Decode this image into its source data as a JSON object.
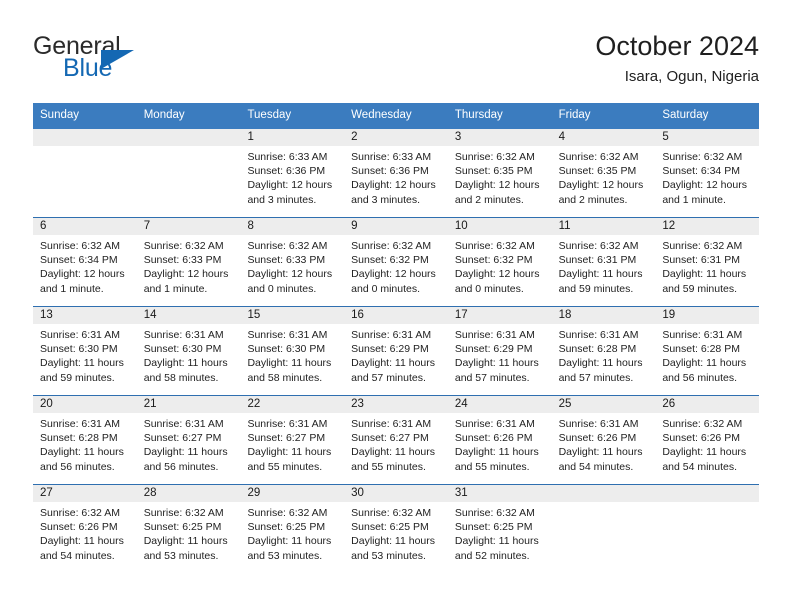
{
  "logo": {
    "primary_text": "General",
    "secondary_text": "Blue",
    "primary_color": "#2b2b2b",
    "secondary_color": "#1468b3",
    "triangle_icon": "triangle-right-icon"
  },
  "header": {
    "title": "October 2024",
    "subtitle": "Isara, Ogun, Nigeria"
  },
  "theme": {
    "header_bg": "#3b7cbf",
    "header_text": "#ffffff",
    "row_divider": "#2f6fb0",
    "day_band_bg": "#ededed",
    "cell_bg": "#ffffff"
  },
  "weekdays": [
    "Sunday",
    "Monday",
    "Tuesday",
    "Wednesday",
    "Thursday",
    "Friday",
    "Saturday"
  ],
  "weeks": [
    [
      {
        "day": "",
        "sunrise": "",
        "sunset": "",
        "daylight_line1": "",
        "daylight_line2": "",
        "empty": true
      },
      {
        "day": "",
        "sunrise": "",
        "sunset": "",
        "daylight_line1": "",
        "daylight_line2": "",
        "empty": true
      },
      {
        "day": "1",
        "sunrise": "Sunrise: 6:33 AM",
        "sunset": "Sunset: 6:36 PM",
        "daylight_line1": "Daylight: 12 hours",
        "daylight_line2": "and 3 minutes.",
        "empty": false
      },
      {
        "day": "2",
        "sunrise": "Sunrise: 6:33 AM",
        "sunset": "Sunset: 6:36 PM",
        "daylight_line1": "Daylight: 12 hours",
        "daylight_line2": "and 3 minutes.",
        "empty": false
      },
      {
        "day": "3",
        "sunrise": "Sunrise: 6:32 AM",
        "sunset": "Sunset: 6:35 PM",
        "daylight_line1": "Daylight: 12 hours",
        "daylight_line2": "and 2 minutes.",
        "empty": false
      },
      {
        "day": "4",
        "sunrise": "Sunrise: 6:32 AM",
        "sunset": "Sunset: 6:35 PM",
        "daylight_line1": "Daylight: 12 hours",
        "daylight_line2": "and 2 minutes.",
        "empty": false
      },
      {
        "day": "5",
        "sunrise": "Sunrise: 6:32 AM",
        "sunset": "Sunset: 6:34 PM",
        "daylight_line1": "Daylight: 12 hours",
        "daylight_line2": "and 1 minute.",
        "empty": false
      }
    ],
    [
      {
        "day": "6",
        "sunrise": "Sunrise: 6:32 AM",
        "sunset": "Sunset: 6:34 PM",
        "daylight_line1": "Daylight: 12 hours",
        "daylight_line2": "and 1 minute.",
        "empty": false
      },
      {
        "day": "7",
        "sunrise": "Sunrise: 6:32 AM",
        "sunset": "Sunset: 6:33 PM",
        "daylight_line1": "Daylight: 12 hours",
        "daylight_line2": "and 1 minute.",
        "empty": false
      },
      {
        "day": "8",
        "sunrise": "Sunrise: 6:32 AM",
        "sunset": "Sunset: 6:33 PM",
        "daylight_line1": "Daylight: 12 hours",
        "daylight_line2": "and 0 minutes.",
        "empty": false
      },
      {
        "day": "9",
        "sunrise": "Sunrise: 6:32 AM",
        "sunset": "Sunset: 6:32 PM",
        "daylight_line1": "Daylight: 12 hours",
        "daylight_line2": "and 0 minutes.",
        "empty": false
      },
      {
        "day": "10",
        "sunrise": "Sunrise: 6:32 AM",
        "sunset": "Sunset: 6:32 PM",
        "daylight_line1": "Daylight: 12 hours",
        "daylight_line2": "and 0 minutes.",
        "empty": false
      },
      {
        "day": "11",
        "sunrise": "Sunrise: 6:32 AM",
        "sunset": "Sunset: 6:31 PM",
        "daylight_line1": "Daylight: 11 hours",
        "daylight_line2": "and 59 minutes.",
        "empty": false
      },
      {
        "day": "12",
        "sunrise": "Sunrise: 6:32 AM",
        "sunset": "Sunset: 6:31 PM",
        "daylight_line1": "Daylight: 11 hours",
        "daylight_line2": "and 59 minutes.",
        "empty": false
      }
    ],
    [
      {
        "day": "13",
        "sunrise": "Sunrise: 6:31 AM",
        "sunset": "Sunset: 6:30 PM",
        "daylight_line1": "Daylight: 11 hours",
        "daylight_line2": "and 59 minutes.",
        "empty": false
      },
      {
        "day": "14",
        "sunrise": "Sunrise: 6:31 AM",
        "sunset": "Sunset: 6:30 PM",
        "daylight_line1": "Daylight: 11 hours",
        "daylight_line2": "and 58 minutes.",
        "empty": false
      },
      {
        "day": "15",
        "sunrise": "Sunrise: 6:31 AM",
        "sunset": "Sunset: 6:30 PM",
        "daylight_line1": "Daylight: 11 hours",
        "daylight_line2": "and 58 minutes.",
        "empty": false
      },
      {
        "day": "16",
        "sunrise": "Sunrise: 6:31 AM",
        "sunset": "Sunset: 6:29 PM",
        "daylight_line1": "Daylight: 11 hours",
        "daylight_line2": "and 57 minutes.",
        "empty": false
      },
      {
        "day": "17",
        "sunrise": "Sunrise: 6:31 AM",
        "sunset": "Sunset: 6:29 PM",
        "daylight_line1": "Daylight: 11 hours",
        "daylight_line2": "and 57 minutes.",
        "empty": false
      },
      {
        "day": "18",
        "sunrise": "Sunrise: 6:31 AM",
        "sunset": "Sunset: 6:28 PM",
        "daylight_line1": "Daylight: 11 hours",
        "daylight_line2": "and 57 minutes.",
        "empty": false
      },
      {
        "day": "19",
        "sunrise": "Sunrise: 6:31 AM",
        "sunset": "Sunset: 6:28 PM",
        "daylight_line1": "Daylight: 11 hours",
        "daylight_line2": "and 56 minutes.",
        "empty": false
      }
    ],
    [
      {
        "day": "20",
        "sunrise": "Sunrise: 6:31 AM",
        "sunset": "Sunset: 6:28 PM",
        "daylight_line1": "Daylight: 11 hours",
        "daylight_line2": "and 56 minutes.",
        "empty": false
      },
      {
        "day": "21",
        "sunrise": "Sunrise: 6:31 AM",
        "sunset": "Sunset: 6:27 PM",
        "daylight_line1": "Daylight: 11 hours",
        "daylight_line2": "and 56 minutes.",
        "empty": false
      },
      {
        "day": "22",
        "sunrise": "Sunrise: 6:31 AM",
        "sunset": "Sunset: 6:27 PM",
        "daylight_line1": "Daylight: 11 hours",
        "daylight_line2": "and 55 minutes.",
        "empty": false
      },
      {
        "day": "23",
        "sunrise": "Sunrise: 6:31 AM",
        "sunset": "Sunset: 6:27 PM",
        "daylight_line1": "Daylight: 11 hours",
        "daylight_line2": "and 55 minutes.",
        "empty": false
      },
      {
        "day": "24",
        "sunrise": "Sunrise: 6:31 AM",
        "sunset": "Sunset: 6:26 PM",
        "daylight_line1": "Daylight: 11 hours",
        "daylight_line2": "and 55 minutes.",
        "empty": false
      },
      {
        "day": "25",
        "sunrise": "Sunrise: 6:31 AM",
        "sunset": "Sunset: 6:26 PM",
        "daylight_line1": "Daylight: 11 hours",
        "daylight_line2": "and 54 minutes.",
        "empty": false
      },
      {
        "day": "26",
        "sunrise": "Sunrise: 6:32 AM",
        "sunset": "Sunset: 6:26 PM",
        "daylight_line1": "Daylight: 11 hours",
        "daylight_line2": "and 54 minutes.",
        "empty": false
      }
    ],
    [
      {
        "day": "27",
        "sunrise": "Sunrise: 6:32 AM",
        "sunset": "Sunset: 6:26 PM",
        "daylight_line1": "Daylight: 11 hours",
        "daylight_line2": "and 54 minutes.",
        "empty": false
      },
      {
        "day": "28",
        "sunrise": "Sunrise: 6:32 AM",
        "sunset": "Sunset: 6:25 PM",
        "daylight_line1": "Daylight: 11 hours",
        "daylight_line2": "and 53 minutes.",
        "empty": false
      },
      {
        "day": "29",
        "sunrise": "Sunrise: 6:32 AM",
        "sunset": "Sunset: 6:25 PM",
        "daylight_line1": "Daylight: 11 hours",
        "daylight_line2": "and 53 minutes.",
        "empty": false
      },
      {
        "day": "30",
        "sunrise": "Sunrise: 6:32 AM",
        "sunset": "Sunset: 6:25 PM",
        "daylight_line1": "Daylight: 11 hours",
        "daylight_line2": "and 53 minutes.",
        "empty": false
      },
      {
        "day": "31",
        "sunrise": "Sunrise: 6:32 AM",
        "sunset": "Sunset: 6:25 PM",
        "daylight_line1": "Daylight: 11 hours",
        "daylight_line2": "and 52 minutes.",
        "empty": false
      },
      {
        "day": "",
        "sunrise": "",
        "sunset": "",
        "daylight_line1": "",
        "daylight_line2": "",
        "empty": true
      },
      {
        "day": "",
        "sunrise": "",
        "sunset": "",
        "daylight_line1": "",
        "daylight_line2": "",
        "empty": true
      }
    ]
  ]
}
